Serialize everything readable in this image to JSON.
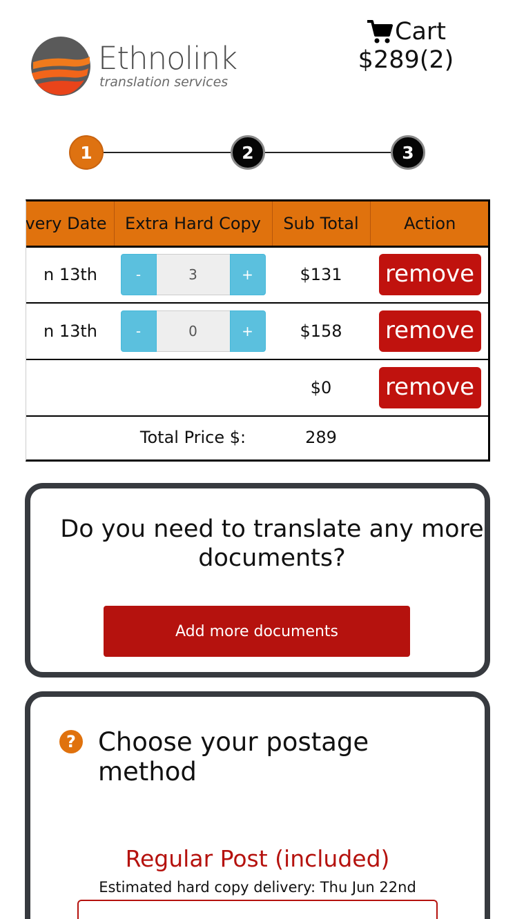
{
  "header": {
    "logo_name": "Ethnolink",
    "logo_tagline": "translation services",
    "cart_label": "Cart",
    "cart_total": "$289(2)",
    "brand_color": "#e0720d"
  },
  "steps": [
    "1",
    "2",
    "3"
  ],
  "active_step": 1,
  "table": {
    "headers": [
      "ivery Date",
      "Extra Hard Copy",
      "Sub Total",
      "Action"
    ],
    "rows": [
      {
        "date": "n 13th",
        "qty_minus": "-",
        "qty_value": "3",
        "qty_plus": "+",
        "subtotal": "$131",
        "action": "remove"
      },
      {
        "date": "n 13th",
        "qty_minus": "-",
        "qty_value": "0",
        "qty_plus": "+",
        "subtotal": "$158",
        "action": "remove"
      },
      {
        "date": "",
        "subtotal": "$0",
        "action": "remove"
      }
    ],
    "total_label": "Total Price $:",
    "total_value": "289"
  },
  "more_docs": {
    "title": "Do you need to translate any more documents?",
    "button": "Add more documents"
  },
  "postage": {
    "help_icon": "question-circle-icon",
    "title": "Choose your postage method",
    "option_title": "Regular Post (included)",
    "option_sub": "Estimated hard copy delivery: Thu Jun 22nd"
  }
}
